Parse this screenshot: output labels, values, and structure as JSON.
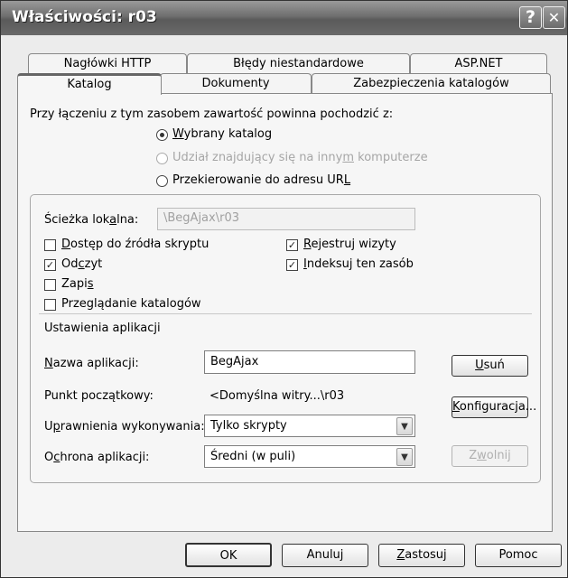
{
  "window": {
    "title": "Właściwości: r03",
    "help_glyph": "?",
    "close_glyph": "✕"
  },
  "tabs": {
    "row1": [
      "Nagłówki HTTP",
      "Błędy niestandardowe",
      "ASP.NET"
    ],
    "row2": [
      "Katalog",
      "Dokumenty",
      "Zabezpieczenia katalogów"
    ]
  },
  "source": {
    "label": "Przy łączeniu z tym zasobem zawartość powinna pochodzić z:",
    "opt1_pre": "",
    "opt1_key": "W",
    "opt1_post": "ybrany katalog",
    "opt2_pre": "Udział znajdujący się na inny",
    "opt2_key": "m",
    "opt2_post": " komputerze",
    "opt3_pre": "Przekierowanie do adresu UR",
    "opt3_key": "L",
    "opt3_post": "",
    "selected": "opt1"
  },
  "local_path": {
    "label_pre": "Ścieżka lok",
    "label_key": "a",
    "label_post": "lna:",
    "value": "\\BegAjax\\r03"
  },
  "checks": {
    "script_pre": "",
    "script_key": "D",
    "script_post": "ostęp do źródła skryptu",
    "script_checked": false,
    "read_pre": "Od",
    "read_key": "c",
    "read_post": "zyt",
    "read_checked": true,
    "write_pre": "Zapi",
    "write_key": "s",
    "write_post": "",
    "write_checked": false,
    "browse_pre": "Przeglądanie katalogów",
    "browse_key": "",
    "browse_post": "",
    "browse_checked": false,
    "log_pre": "",
    "log_key": "R",
    "log_post": "ejestruj wizyty",
    "log_checked": true,
    "index_pre": "",
    "index_key": "I",
    "index_post": "ndeksuj ten zasób",
    "index_checked": true
  },
  "app": {
    "section_title": "Ustawienia aplikacji",
    "name_label_pre": "",
    "name_label_key": "N",
    "name_label_post": "azwa aplikacji:",
    "name_value": "BegAjax",
    "start_label": "Punkt początkowy:",
    "start_value": "<Domyślna witry...\\r03",
    "perm_label_pre": "U",
    "perm_label_key": "p",
    "perm_label_post": "rawnienia wykonywania:",
    "perm_value": "Tylko skrypty",
    "prot_label_pre": "O",
    "prot_label_key": "c",
    "prot_label_post": "hrona aplikacji:",
    "prot_value": "Średni (w puli)",
    "remove_pre": "",
    "remove_key": "U",
    "remove_post": "suń",
    "config_pre": "",
    "config_key": "K",
    "config_post": "onfiguracja...",
    "unload_pre": "Z",
    "unload_key": "w",
    "unload_post": "olnij"
  },
  "dialog_buttons": {
    "ok": "OK",
    "cancel": "Anuluj",
    "apply_pre": "",
    "apply_key": "Z",
    "apply_post": "astosuj",
    "help": "Pomoc"
  },
  "icons": {
    "checkmark": "✓",
    "dropdown_arrow": "▼"
  }
}
